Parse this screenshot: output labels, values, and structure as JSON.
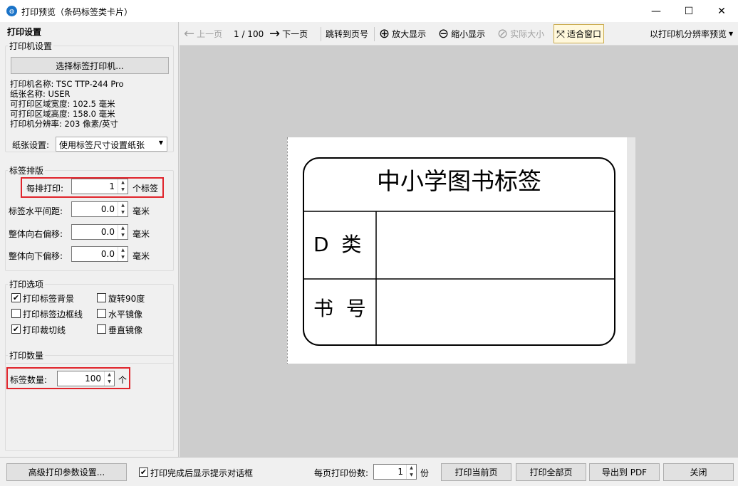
{
  "window": {
    "title": "打印预览（条码标签类卡片）",
    "app_icon_text": "◍",
    "minimize": "—",
    "maximize": "☐",
    "close": "✕"
  },
  "panel": {
    "title": "打印设置",
    "printer_group": {
      "label": "打印机设置",
      "select_button": "选择标签打印机...",
      "info": [
        "打印机名称: TSC TTP-244 Pro",
        "纸张名称: USER",
        "可打印区域宽度: 102.5 毫米",
        "可打印区域高度: 158.0 毫米",
        "打印机分辨率: 203 像素/英寸"
      ],
      "paper_label": "纸张设置:",
      "paper_value": "使用标签尺寸设置纸张"
    },
    "layout_group": {
      "label": "标签排版",
      "per_row_label": "每排打印:",
      "per_row_value": "1",
      "per_row_unit": "个标签",
      "h_gap_label": "标签水平间距:",
      "h_gap_value": "0.0",
      "h_gap_unit": "毫米",
      "right_offset_label": "整体向右偏移:",
      "right_offset_value": "0.0",
      "right_offset_unit": "毫米",
      "down_offset_label": "整体向下偏移:",
      "down_offset_value": "0.0",
      "down_offset_unit": "毫米"
    },
    "options_group": {
      "label": "打印选项",
      "print_bg": {
        "label": "打印标签背景",
        "checked": true
      },
      "rotate": {
        "label": "旋转90度",
        "checked": false
      },
      "print_border": {
        "label": "打印标签边框线",
        "checked": false
      },
      "h_mirror": {
        "label": "水平镜像",
        "checked": false
      },
      "print_cut": {
        "label": "打印裁切线",
        "checked": true
      },
      "v_mirror": {
        "label": "垂直镜像",
        "checked": false
      }
    },
    "qty_group": {
      "label": "打印数量",
      "qty_label": "标签数量:",
      "qty_value": "100",
      "qty_unit": "个"
    }
  },
  "toolbar": {
    "prev": "上一页",
    "page_indicator": "1 / 100",
    "next": "下一页",
    "jump": "跳转到页号",
    "zoom_in": "放大显示",
    "zoom_out": "缩小显示",
    "actual_size": "实际大小",
    "fit_window": "适合窗口",
    "preview_mode": "以打印机分辨率预览"
  },
  "label": {
    "title": "中小学图书标签",
    "row1": "D  类",
    "row2": "书  号"
  },
  "bottom": {
    "advanced": "高级打印参数设置...",
    "show_dialog": {
      "label": "打印完成后显示提示对话框",
      "checked": true
    },
    "copies_label": "每页打印份数:",
    "copies_value": "1",
    "copies_unit": "份",
    "print_current": "打印当前页",
    "print_all": "打印全部页",
    "export_pdf": "导出到 PDF",
    "close": "关闭"
  }
}
